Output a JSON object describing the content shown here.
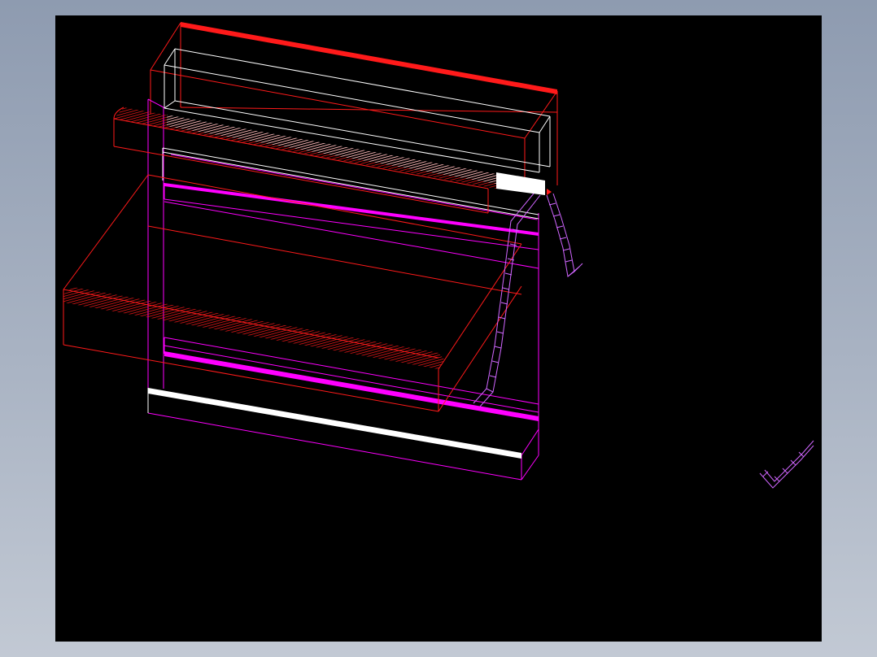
{
  "app": {
    "viewport_background": "#000000",
    "frame_background": "#a2acbd"
  },
  "palette": {
    "red": "#ff1a1a",
    "magenta": "#ff00ff",
    "white": "#ffffff",
    "violet": "#d066ff"
  },
  "icons": {
    "drawing": "cad-wireframe-drawing"
  }
}
